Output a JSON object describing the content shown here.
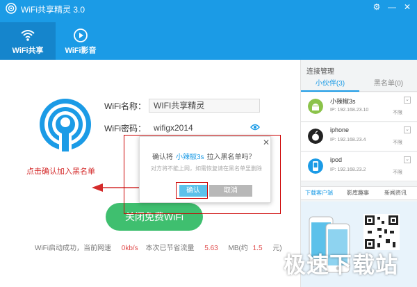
{
  "app": {
    "title": "WiFi共享精灵 3.0",
    "accent_color": "#1b9be6",
    "window_controls": [
      "gear-icon",
      "minimize-icon",
      "close-icon"
    ]
  },
  "nav": {
    "tabs": [
      {
        "label": "WiFi共享",
        "icon": "wifi-icon",
        "active": true
      },
      {
        "label": "WiFi影音",
        "icon": "play-icon",
        "active": false
      }
    ]
  },
  "form": {
    "name_label": "WiFi名称：",
    "name_value": "WIFI共享精灵",
    "password_label": "WiFi密码：",
    "password_value": "wifigx2014"
  },
  "close_button": "关闭免费WiFi",
  "status": {
    "prefix": "WiFi启动成功，当前网速",
    "speed": "0kb/s",
    "middle": "本次已节省流量",
    "saved": "5.63",
    "unit": "MB(约",
    "money": "1.5",
    "suffix": "元)"
  },
  "annotation": {
    "text": "点击确认加入黑名单",
    "color": "#d42b2b"
  },
  "dialog": {
    "question_prefix": "确认将",
    "target_name": "小辣椒3s",
    "question_suffix": "拉入黑名单吗？",
    "sub_text": "对方将不能上网，如需恢复请在黑名单里删除",
    "confirm_label": "确认",
    "cancel_label": "取消",
    "close_icon": "close-icon"
  },
  "right_panel": {
    "title": "连接管理",
    "tabs": [
      {
        "label": "小伙伴(3)",
        "active": true
      },
      {
        "label": "黑名单(0)",
        "active": false
      }
    ],
    "devices": [
      {
        "name": "小辣椒3s",
        "ip": "IP: 192.168.23.10",
        "limit": "不限",
        "icon": "android-icon",
        "color": "#8bc34a"
      },
      {
        "name": "iphone",
        "ip": "IP: 192.168.23.4",
        "limit": "不限",
        "icon": "apple-icon",
        "color": "#333333"
      },
      {
        "name": "ipod",
        "ip": "IP: 192.168.23.2",
        "limit": "不限",
        "icon": "ipod-icon",
        "color": "#1b9be6"
      }
    ],
    "bottom_tabs": [
      {
        "label": "下载客户端",
        "active": true
      },
      {
        "label": "影库趣事",
        "active": false
      },
      {
        "label": "新闻资讯",
        "active": false
      }
    ]
  },
  "watermark": "极速下载站"
}
